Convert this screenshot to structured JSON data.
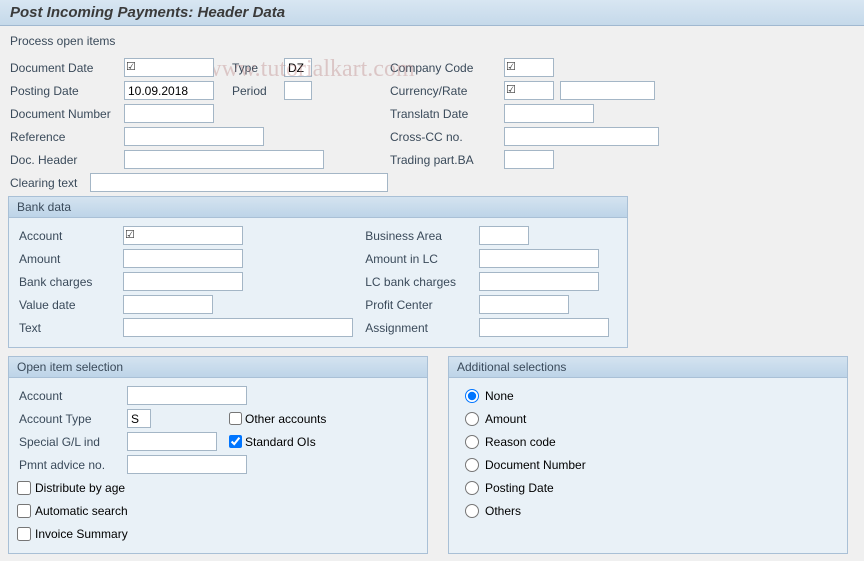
{
  "title": "Post Incoming Payments: Header Data",
  "toolbar": {
    "process_open_items": "Process open items"
  },
  "watermark": "© www.tutorialkart.com",
  "header_left": {
    "document_date_label": "Document Date",
    "document_date_value": "",
    "type_label": "Type",
    "type_value": "DZ",
    "posting_date_label": "Posting Date",
    "posting_date_value": "10.09.2018",
    "period_label": "Period",
    "period_value": "",
    "document_number_label": "Document Number",
    "document_number_value": "",
    "reference_label": "Reference",
    "reference_value": "",
    "doc_header_label": "Doc. Header",
    "doc_header_value": "",
    "clearing_text_label": "Clearing text",
    "clearing_text_value": ""
  },
  "header_right": {
    "company_code_label": "Company Code",
    "company_code_value": "",
    "currency_rate_label": "Currency/Rate",
    "currency_rate_value": "",
    "currency_rate_value2": "",
    "translatn_date_label": "Translatn Date",
    "translatn_date_value": "",
    "cross_cc_label": "Cross-CC no.",
    "cross_cc_value": "",
    "trading_part_label": "Trading part.BA",
    "trading_part_value": ""
  },
  "bank_data": {
    "title": "Bank data",
    "left": {
      "account_label": "Account",
      "account_value": "",
      "amount_label": "Amount",
      "amount_value": "",
      "bank_charges_label": "Bank charges",
      "bank_charges_value": "",
      "value_date_label": "Value date",
      "value_date_value": "",
      "text_label": "Text",
      "text_value": ""
    },
    "right": {
      "business_area_label": "Business Area",
      "business_area_value": "",
      "amount_lc_label": "Amount in LC",
      "amount_lc_value": "",
      "lc_bank_charges_label": "LC bank charges",
      "lc_bank_charges_value": "",
      "profit_center_label": "Profit Center",
      "profit_center_value": "",
      "assignment_label": "Assignment",
      "assignment_value": ""
    }
  },
  "open_item": {
    "title": "Open item selection",
    "account_label": "Account",
    "account_value": "",
    "account_type_label": "Account Type",
    "account_type_value": "S",
    "other_accounts_label": "Other accounts",
    "special_gl_label": "Special G/L ind",
    "special_gl_value": "",
    "standard_ois_label": "Standard OIs",
    "pmnt_advice_label": "Pmnt advice no.",
    "pmnt_advice_value": "",
    "distribute_by_age_label": "Distribute by age",
    "automatic_search_label": "Automatic search",
    "invoice_summary_label": "Invoice Summary"
  },
  "additional": {
    "title": "Additional selections",
    "none_label": "None",
    "amount_label": "Amount",
    "reason_code_label": "Reason code",
    "document_number_label": "Document Number",
    "posting_date_label": "Posting Date",
    "others_label": "Others"
  }
}
